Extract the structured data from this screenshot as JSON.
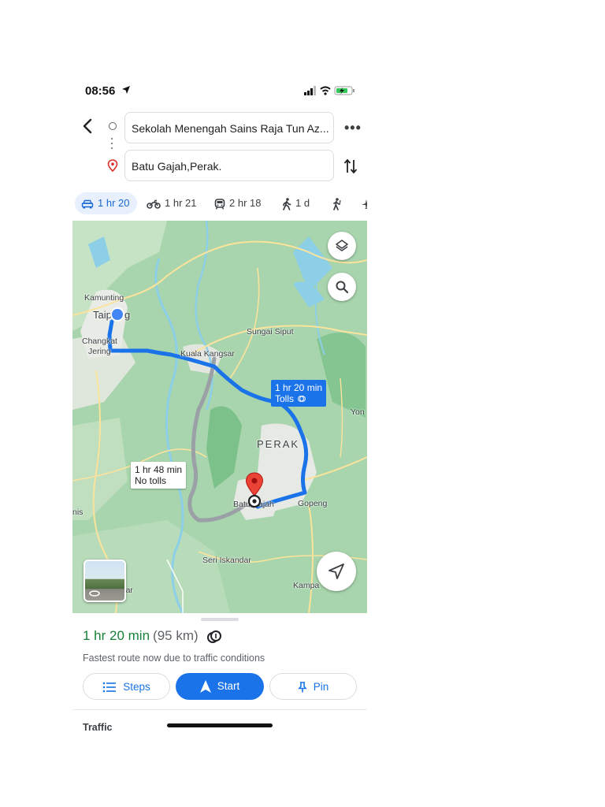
{
  "status_bar": {
    "time": "08:56"
  },
  "directions": {
    "origin": "Sekolah Menengah Sains Raja Tun Az...",
    "destination": "Batu Gajah,Perak."
  },
  "modes": [
    {
      "label": "1 hr 20",
      "icon": "car-icon",
      "active": true
    },
    {
      "label": "1 hr 21",
      "icon": "motorcycle-icon"
    },
    {
      "label": "2 hr 18",
      "icon": "train-icon"
    },
    {
      "label": "1 d",
      "icon": "walk-icon"
    }
  ],
  "map": {
    "places": {
      "kamunting": "Kamunting",
      "taiping_a": "Taip",
      "taiping_b": "g",
      "changkat": "Changkat",
      "jering": "Jering",
      "kuala_kangsar": "Kuala Kangsar",
      "sungai_siput": "Sungai Siput",
      "yon": "Yon",
      "perak": "PERAK",
      "gopeng": "Gopeng",
      "batu_gajah_a": "Batu",
      "batu_gajah_b": "ajah",
      "nis": "nis",
      "seri_iskandar": "Seri Iskandar",
      "kampa": "Kampa",
      "war": "war"
    },
    "primary_route": {
      "duration": "1 hr 20 min",
      "note": "Tolls",
      "color": "#1a73e8"
    },
    "alt_route": {
      "duration": "1 hr 48 min",
      "note": "No tolls",
      "color": "#9aa0a6"
    }
  },
  "sheet": {
    "duration": "1 hr 20 min",
    "distance": "(95 km)",
    "note": "Fastest route now due to traffic conditions",
    "steps_label": "Steps",
    "start_label": "Start",
    "pin_label": "Pin",
    "traffic_label": "Traffic"
  }
}
